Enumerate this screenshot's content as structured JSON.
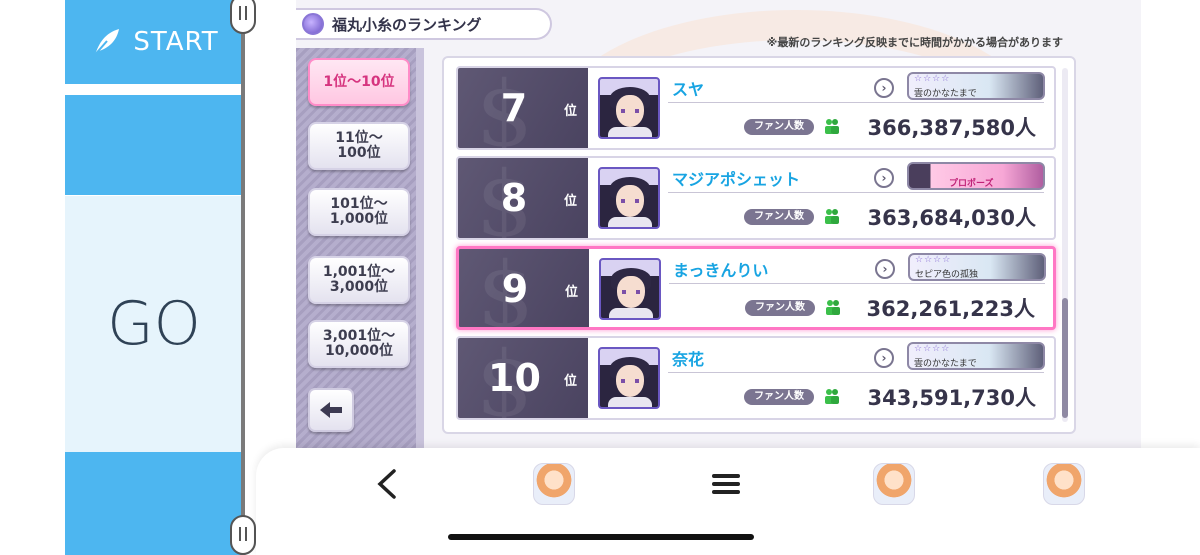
{
  "left_panel": {
    "start_label": "START",
    "go_label": "GO"
  },
  "game": {
    "title": "福丸小糸のランキング",
    "notice": "※最新のランキング反映までに時間がかかる場合があります",
    "nav": [
      {
        "label": "1位〜10位",
        "active": true
      },
      {
        "label": "11位〜\n100位",
        "active": false
      },
      {
        "label": "101位〜\n1,000位",
        "active": false
      },
      {
        "label": "1,001位〜\n3,000位",
        "active": false
      },
      {
        "label": "3,001位〜\n10,000位",
        "active": false
      }
    ],
    "rank_suffix": "位",
    "fan_label": "ファン人数",
    "rows": [
      {
        "rank": "7",
        "name": "スヤ",
        "card_stars": "☆☆☆☆",
        "card_name": "雲のかなたまで",
        "card_style": "blue",
        "fans": "366,387,580人",
        "highlighted": false
      },
      {
        "rank": "8",
        "name": "マジアポシェット",
        "card_stars": "",
        "card_name": "プロポーズ",
        "card_style": "pink",
        "fans": "363,684,030人",
        "highlighted": false
      },
      {
        "rank": "9",
        "name": "まっきんりい",
        "card_stars": "☆☆☆☆",
        "card_name": "セピア色の孤独",
        "card_style": "blue",
        "fans": "362,261,223人",
        "highlighted": true
      },
      {
        "rank": "10",
        "name": "奈花",
        "card_stars": "☆☆☆☆",
        "card_name": "雲のかなたまで",
        "card_style": "blue",
        "fans": "343,591,730人",
        "highlighted": false
      }
    ]
  },
  "bottom_nav": {
    "back_icon": "chevron-left-icon",
    "menu_icon": "hamburger-icon"
  },
  "colors": {
    "accent_blue": "#4db6f0",
    "highlight_pink": "#ff77c4",
    "name_blue": "#18a4e2"
  }
}
